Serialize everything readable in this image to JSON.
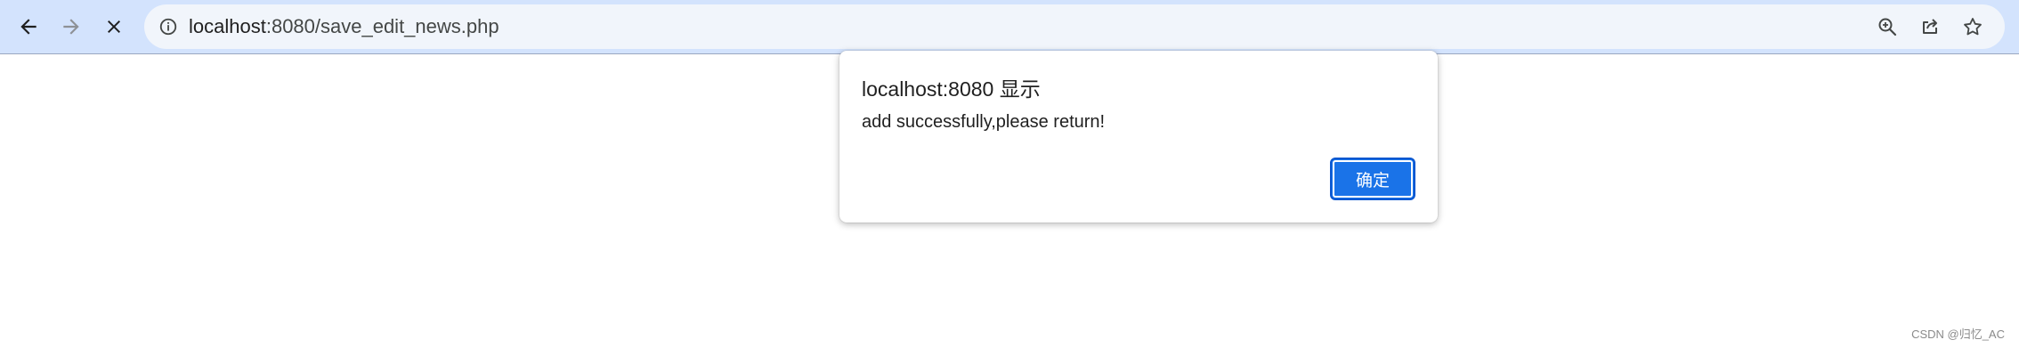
{
  "browser": {
    "nav": {
      "back_icon": "arrow-left-icon",
      "forward_icon": "arrow-right-icon",
      "stop_icon": "close-icon"
    },
    "omnibox": {
      "info_icon": "info-icon",
      "url_host": "localhost",
      "url_rest": ":8080/save_edit_news.php",
      "right_icons": [
        "zoom-icon",
        "share-icon",
        "star-icon"
      ]
    },
    "colors": {
      "toolbar_bg": "#d3e3fd",
      "omnibox_bg": "#f1f5fb",
      "accent": "#1a73e8"
    }
  },
  "dialog": {
    "title": "localhost:8080 显示",
    "message": "add successfully,please return!",
    "ok_label": "确定"
  },
  "watermark": {
    "text": "CSDN @归忆_AC"
  }
}
